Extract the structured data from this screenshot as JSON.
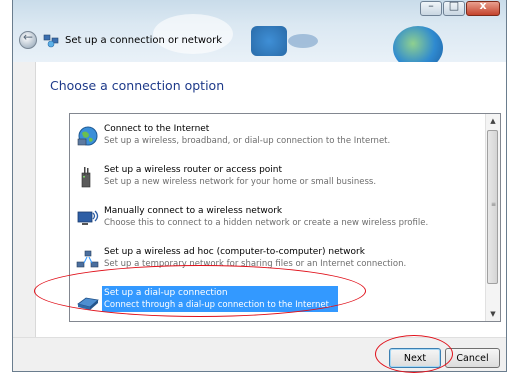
{
  "window": {
    "title": "Set up a connection or network",
    "controls": {
      "minimize": "–",
      "maximize": "□",
      "close": "x"
    }
  },
  "heading": "Choose a connection option",
  "options": [
    {
      "title": "Connect to the Internet",
      "description": "Set up a wireless, broadband, or dial-up connection to the Internet.",
      "icon": "globe-icon"
    },
    {
      "title": "Set up a wireless router or access point",
      "description": "Set up a new wireless network for your home or small business.",
      "icon": "router-icon"
    },
    {
      "title": "Manually connect to a wireless network",
      "description": "Choose this to connect to a hidden network or create a new wireless profile.",
      "icon": "wireless-computer-icon"
    },
    {
      "title": "Set up a wireless ad hoc (computer-to-computer) network",
      "description": "Set up a temporary network for sharing files or an Internet connection.",
      "icon": "adhoc-network-icon"
    },
    {
      "title": "Set up a dial-up connection",
      "description": "Connect through a dial-up connection to the Internet.",
      "icon": "dialup-modem-icon",
      "selected": true
    }
  ],
  "buttons": {
    "next": "Next",
    "cancel": "Cancel"
  },
  "colors": {
    "selection": "#3399ff",
    "heading": "#1e3a8a",
    "annotation": "#e0101a"
  }
}
